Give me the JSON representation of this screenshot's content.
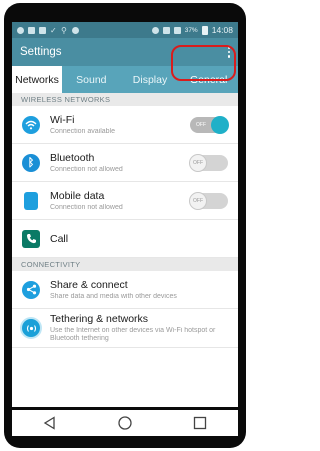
{
  "status_bar": {
    "battery_percent": "37%",
    "time": "14:08"
  },
  "app_bar": {
    "title": "Settings",
    "menu_icon": "overflow-menu-icon"
  },
  "tabs": [
    {
      "label": "Networks",
      "active": true
    },
    {
      "label": "Sound",
      "active": false
    },
    {
      "label": "Display",
      "active": false
    },
    {
      "label": "General",
      "active": false,
      "highlighted": true
    }
  ],
  "sections": {
    "wireless": "WIRELESS NETWORKS",
    "connectivity": "CONNECTIVITY"
  },
  "items": {
    "wifi": {
      "title": "Wi-Fi",
      "subtitle": "Connection available",
      "toggle_state": "on",
      "toggle_text": "OFF",
      "icon": "wifi-icon"
    },
    "bluetooth": {
      "title": "Bluetooth",
      "subtitle": "Connection not allowed",
      "toggle_state": "off",
      "toggle_text": "OFF",
      "icon": "bluetooth-icon"
    },
    "mobile_data": {
      "title": "Mobile data",
      "subtitle": "Connection not allowed",
      "toggle_state": "off",
      "toggle_text": "OFF",
      "icon": "mobile-data-icon"
    },
    "call": {
      "title": "Call",
      "icon": "phone-icon"
    },
    "share": {
      "title": "Share & connect",
      "subtitle": "Share data and media with other devices",
      "icon": "share-icon"
    },
    "tethering": {
      "title": "Tethering & networks",
      "subtitle": "Use the Internet on other devices via Wi-Fi hotspot or Bluetooth tethering",
      "icon": "tethering-icon"
    }
  },
  "nav": [
    "back-icon",
    "home-icon",
    "recents-icon"
  ],
  "colors": {
    "accent": "#58a4ba",
    "highlight": "#d91c1c",
    "toggle_on": "#1fb0c8"
  }
}
